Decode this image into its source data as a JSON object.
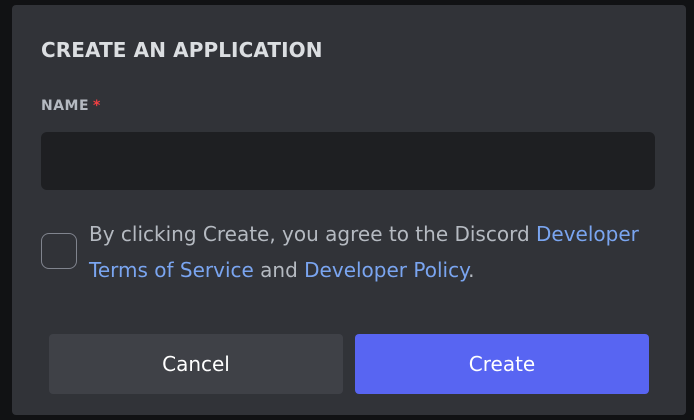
{
  "modal": {
    "title": "CREATE AN APPLICATION",
    "name_field": {
      "label": "NAME",
      "required_marker": "*",
      "value": "",
      "placeholder": ""
    },
    "agreement": {
      "checked": false,
      "text_before": "By clicking Create, you agree to the Discord ",
      "link_terms": "Developer Terms of Service",
      "text_middle": " and ",
      "link_policy": "Developer Policy",
      "text_after": "."
    },
    "buttons": {
      "cancel_label": "Cancel",
      "create_label": "Create"
    }
  },
  "colors": {
    "backdrop": "#111214",
    "modal_bg": "#313338",
    "input_bg": "#1e1f22",
    "link": "#7aa5f0",
    "required": "#f23f42",
    "primary": "#5865f2",
    "secondary": "#3f4147"
  }
}
